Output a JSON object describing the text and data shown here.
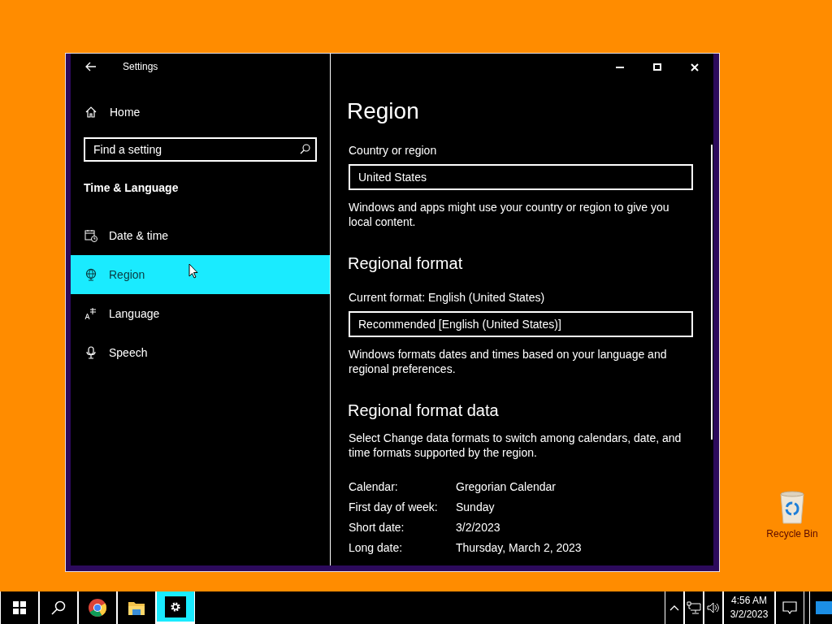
{
  "desktop": {
    "icons": [
      {
        "kind": "recycle-bin",
        "label": "Recycle Bin"
      }
    ]
  },
  "window": {
    "title": "Settings"
  },
  "sidebar": {
    "home": "Home",
    "search": {
      "placeholder": "Find a setting"
    },
    "section": "Time & Language",
    "items": [
      {
        "kind": "date",
        "label": "Date & time",
        "selected": false
      },
      {
        "kind": "region",
        "label": "Region",
        "selected": true
      },
      {
        "kind": "language",
        "label": "Language",
        "selected": false
      },
      {
        "kind": "speech",
        "label": "Speech",
        "selected": false
      }
    ]
  },
  "content": {
    "title": "Region",
    "country": {
      "label": "Country or region",
      "value": "United States",
      "note": "Windows and apps might use your country or region to give you local content."
    },
    "format": {
      "heading": "Regional format",
      "label": "Current format: English (United States)",
      "value": "Recommended [English (United States)]",
      "note": "Windows formats dates and times based on your language and regional preferences."
    },
    "format_data": {
      "heading": "Regional format data",
      "note": "Select Change data formats to switch among calendars, date, and time formats supported by the region.",
      "rows": [
        {
          "label": "Calendar:",
          "value": "Gregorian Calendar"
        },
        {
          "label": "First day of week:",
          "value": "Sunday"
        },
        {
          "label": "Short date:",
          "value": "3/2/2023"
        },
        {
          "label": "Long date:",
          "value": "Thursday, March 2, 2023"
        }
      ]
    }
  },
  "taskbar": {
    "apps": [
      {
        "kind": "start",
        "active": false
      },
      {
        "kind": "search",
        "active": false
      },
      {
        "kind": "chrome",
        "active": false
      },
      {
        "kind": "folder",
        "active": false
      },
      {
        "kind": "settings",
        "active": true
      }
    ],
    "clock": {
      "time": "4:56 AM",
      "date": "3/2/2023"
    }
  }
}
